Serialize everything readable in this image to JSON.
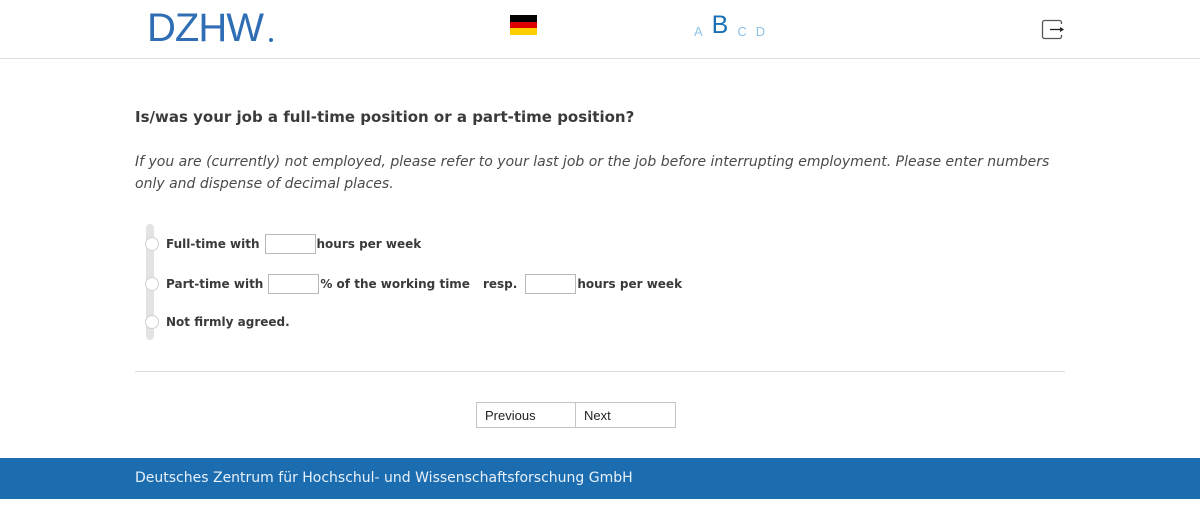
{
  "header": {
    "logo_text": "DZHW.",
    "language": "Deutsch",
    "flag_colors": {
      "black": "#000000",
      "red": "#dd0000",
      "gold": "#ffce00"
    },
    "font_sizes": [
      "A",
      "B",
      "C",
      "D"
    ],
    "font_size_selected": "B",
    "logout_icon": "logout-icon"
  },
  "question": {
    "title": "Is/was your job a full-time position or a part-time position?",
    "instruction": "If you are (currently) not employed, please refer to your last job or the job before interrupting employment. Please enter numbers only and dispense of decimal places."
  },
  "options": {
    "fulltime": {
      "label": "Full-time with",
      "input_value": "",
      "suffix": "hours per week"
    },
    "parttime": {
      "label": "Part-time with",
      "input_value": "",
      "suffix": "% of the working time",
      "connector": "resp.",
      "input2_value": "",
      "suffix2": "hours per week"
    },
    "notagreed": {
      "label": "Not firmly agreed."
    }
  },
  "nav": {
    "previous": "Previous",
    "next": "Next"
  },
  "footer": {
    "text": "Deutsches Zentrum für Hochschul- und Wissenschaftsforschung GmbH"
  },
  "colors": {
    "brand": "#1c6cb0",
    "logo": "#2f6db5",
    "font_switch_inactive": "#8cc3e6"
  }
}
